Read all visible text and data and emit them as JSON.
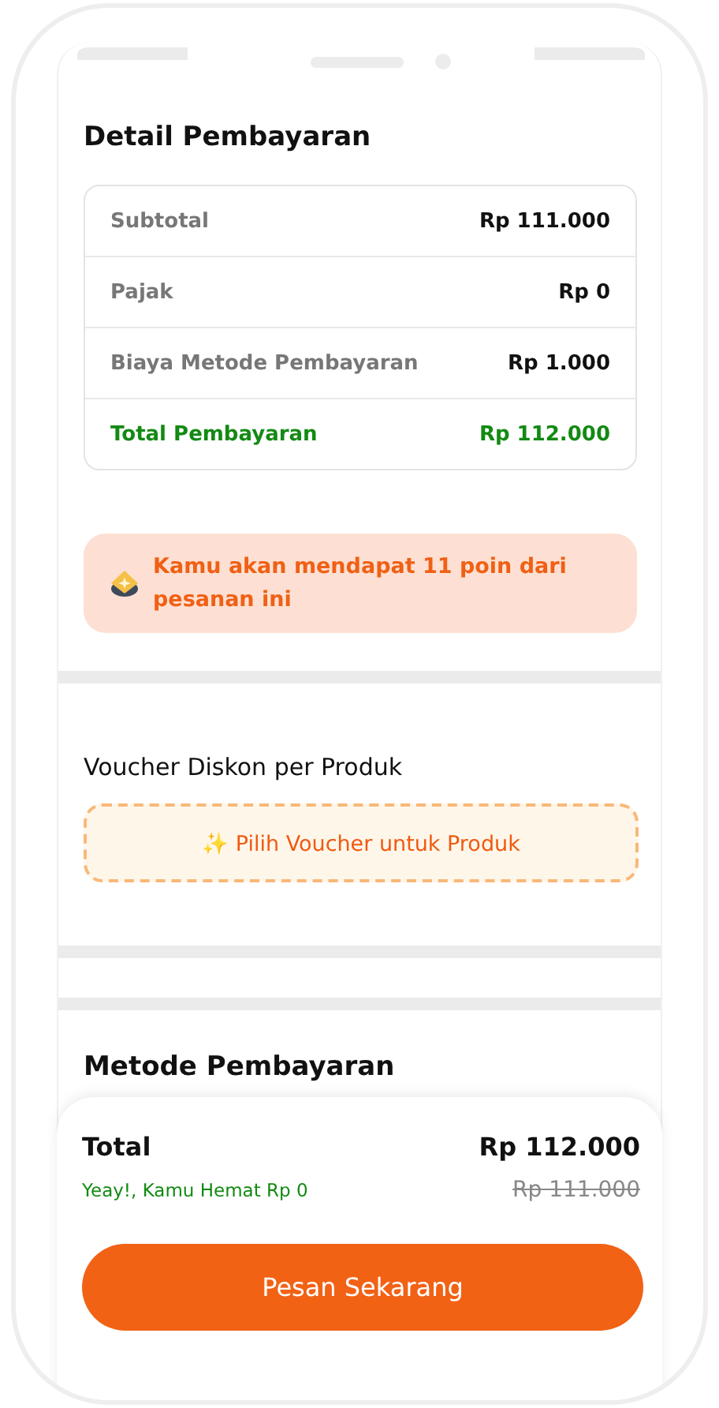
{
  "payment_details": {
    "title": "Detail Pembayaran",
    "rows": [
      {
        "kind": "line",
        "label": "Subtotal",
        "value": "Rp 111.000"
      },
      {
        "kind": "line",
        "label": "Pajak",
        "value": "Rp 0"
      },
      {
        "kind": "line",
        "label": "Biaya Metode Pembayaran",
        "value": "Rp 1.000"
      },
      {
        "kind": "total",
        "label": "Total Pembayaran",
        "value": "Rp 112.000"
      }
    ]
  },
  "points_banner": {
    "text": "Kamu akan mendapat 11 poin dari pesanan ini"
  },
  "product_voucher": {
    "title": "Voucher Diskon per Produk",
    "button": "✨ Pilih Voucher untuk Produk"
  },
  "payment_method": {
    "title": "Metode Pembayaran"
  },
  "footer": {
    "total_label": "Total",
    "total_value": "Rp 112.000",
    "savings": "Yeay!, Kamu Hemat Rp 0",
    "original_price": "Rp 111.000",
    "order_button": "Pesan Sekarang"
  }
}
